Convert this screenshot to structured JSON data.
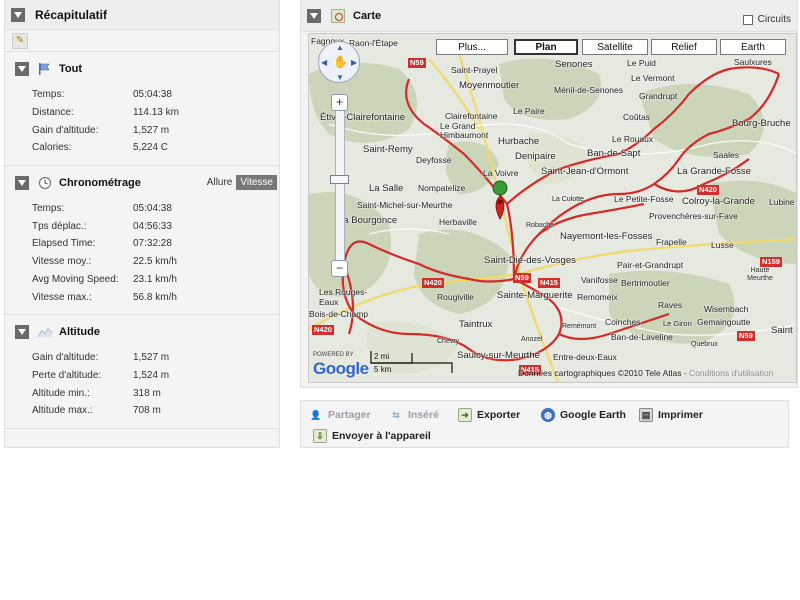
{
  "summary": {
    "title": "Récapitulatif",
    "sections": [
      {
        "title": "Tout",
        "icon": "flag-icon",
        "rows": [
          {
            "label": "Temps:",
            "value": "05:04:38"
          },
          {
            "label": "Distance:",
            "value": "114.13 km"
          },
          {
            "label": "Gain d'altitude:",
            "value": "1,527 m"
          },
          {
            "label": "Calories:",
            "value": "5,224 C"
          }
        ]
      },
      {
        "title": "Chronométrage",
        "icon": "clock-icon",
        "toggle": {
          "option1": "Allure",
          "option2": "Vitesse",
          "selected": "Vitesse"
        },
        "rows": [
          {
            "label": "Temps:",
            "value": "05:04:38"
          },
          {
            "label": "Tps déplac.:",
            "value": "04:56:33"
          },
          {
            "label": "Elapsed Time:",
            "value": "07:32:28"
          },
          {
            "label": "Vitesse moy.:",
            "value": "22.5 km/h"
          },
          {
            "label": "Avg Moving Speed:",
            "value": "23.1 km/h"
          },
          {
            "label": "Vitesse max.:",
            "value": "56.8 km/h"
          }
        ]
      },
      {
        "title": "Altitude",
        "icon": "elevation-chart-icon",
        "rows": [
          {
            "label": "Gain d'altitude:",
            "value": "1,527 m"
          },
          {
            "label": "Perte d'altitude:",
            "value": "1,524 m"
          },
          {
            "label": "Altitude min.:",
            "value": "318 m"
          },
          {
            "label": "Altitude max.:",
            "value": "708 m"
          }
        ]
      }
    ]
  },
  "map_panel": {
    "title": "Carte",
    "circuits_label": "Circuits",
    "map_types": [
      "Plus...",
      "Plan",
      "Satellite",
      "Relief",
      "Earth"
    ],
    "active_map_type": "Plan",
    "scale": {
      "imperial": "2 mi",
      "metric": "5 km"
    },
    "powered_by": "POWERED BY",
    "logo": "Google",
    "copyright": "Données cartographiques ©2010 Tele Atlas -",
    "terms": "Conditions d'utilisation",
    "places": [
      "Fagnoux",
      "Raon-l'Étape",
      "Saint-Prayel",
      "Senones",
      "Le Puid",
      "Saulxures",
      "Moyenmoutier",
      "Le Vermont",
      "Ménil-de-Senones",
      "Grandrupt",
      "Étival-Clairefontaine",
      "Clairefontaine",
      "Le Grand Himbaumont",
      "Le Paire",
      "Hurbache",
      "Le Rouaux",
      "Coûtas",
      "Bourg-Bruche",
      "Saint-Remy",
      "Deyfosse",
      "Denipaire",
      "Ban-de-Sapt",
      "Saales",
      "La Voivre",
      "Saint-Jean-d'Ormont",
      "Nompatelize",
      "La Salle",
      "Le Petite-Fosse",
      "La Grande-Fosse",
      "Saint-Michel-sur-Meurthe",
      "Colroy-la-Grande",
      "Lubine",
      "La Bourgonce",
      "Herbaville",
      "Provenchères-sur-Fave",
      "Nayemont-les-Fosses",
      "Frapelle",
      "Lusse",
      "Saint-Dié-des-Vosges",
      "Pair-et-Grandrupt",
      "Vanifosse",
      "Bertrimoutier",
      "Haute Meurthe",
      "Les Rouges-Eaux",
      "Rougiville",
      "Sainte-Marguerite",
      "Remomeix",
      "Raves",
      "Wisembach",
      "Bois-de-Champ",
      "Coinches",
      "Gemaingoutte",
      "Taintrux",
      "Le Giron",
      "Ban-de-Laveline",
      "Chevry",
      "Saulcy-sur-Meurthe",
      "Entre-deux-Eaux",
      "Robache",
      "La Culotte",
      "Remémont",
      "Anozel",
      "Saint",
      "Quebrux"
    ],
    "road_shields": [
      "N59",
      "N420",
      "N59",
      "N415",
      "N420",
      "N159",
      "N59",
      "N420",
      "N415"
    ]
  },
  "toolbar": {
    "share": "Partager",
    "embed": "Inséré",
    "export": "Exporter",
    "google_earth": "Google Earth",
    "print": "Imprimer",
    "send_to_device": "Envoyer à l'appareil"
  }
}
